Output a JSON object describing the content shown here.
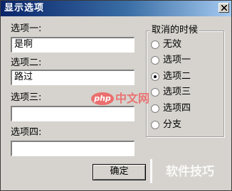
{
  "window": {
    "title": "显示选项"
  },
  "fields": [
    {
      "label": "选项一:",
      "value": "是啊"
    },
    {
      "label": "选项二:",
      "value": "路过"
    },
    {
      "label": "选项三:",
      "value": ""
    },
    {
      "label": "选项四:",
      "value": ""
    }
  ],
  "group": {
    "title": "取消的时候",
    "options": [
      {
        "label": "无效",
        "selected": false
      },
      {
        "label": "选项一",
        "selected": false
      },
      {
        "label": "选项二",
        "selected": true
      },
      {
        "label": "选项三",
        "selected": false
      },
      {
        "label": "选项四",
        "selected": false
      },
      {
        "label": "分支",
        "selected": false
      }
    ]
  },
  "buttons": {
    "ok_label": "确定"
  },
  "watermark": {
    "site_text": "软件技巧",
    "logo_badge": "php",
    "logo_text": "中文网"
  },
  "colors": {
    "titlebar_start": "#0a246a",
    "titlebar_end": "#a6caf0",
    "dialog_background": "#d6d3ce",
    "watermark_red": "#ed5d5d"
  },
  "icons": {
    "close": "close-icon",
    "radio": "radio-button-icon"
  }
}
